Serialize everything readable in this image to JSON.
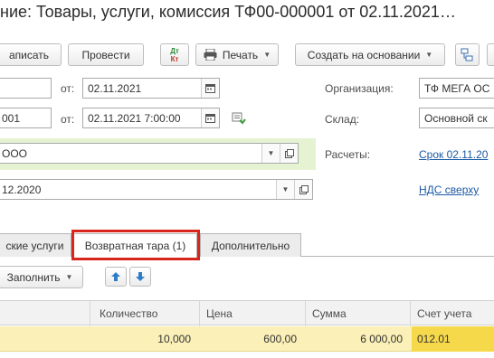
{
  "window": {
    "title": "ние: Товары, услуги, комиссия ТФ00-000001 от 02.11.2021…"
  },
  "toolbar": {
    "post_close_label": "аписать",
    "post_label": "Провести",
    "dt_kt_top": "Дт",
    "dt_kt_bottom": "Кт",
    "print_label": "Печать",
    "create_based_label": "Создать на основании"
  },
  "header_fields": {
    "number_value": "",
    "number_date_label": "от:",
    "number_date_value": "02.11.2021",
    "incoming_number_value": "001",
    "incoming_date_label": "от:",
    "incoming_date_value": "02.11.2021  7:00:00",
    "organization_label": "Организация:",
    "organization_value": "ТФ МЕГА ОС",
    "warehouse_label": "Склад:",
    "warehouse_value": "Основной ск",
    "counterparty_value": "ООО",
    "settlements_label": "Расчеты:",
    "settlements_link": "Срок 02.11.20",
    "contract_value": "12.2020",
    "vat_link": "НДС сверху"
  },
  "tabs": [
    {
      "label": "ские услуги",
      "active": false
    },
    {
      "label": "Возвратная тара (1)",
      "active": true
    },
    {
      "label": "Дополнительно",
      "active": false
    }
  ],
  "table_toolbar": {
    "fill_label": "Заполнить"
  },
  "table": {
    "columns": [
      "Количество",
      "Цена",
      "Сумма",
      "Счет учета"
    ],
    "rows": [
      {
        "quantity": "10,000",
        "price": "600,00",
        "sum": "6 000,00",
        "account": "012.01"
      }
    ]
  },
  "colors": {
    "accent_red": "#d9261c",
    "link_blue": "#1b5aa5",
    "row_highlight": "#fbf0b7",
    "active_cell": "#f6d94b",
    "required_field_bg": "#e6f3d3"
  }
}
